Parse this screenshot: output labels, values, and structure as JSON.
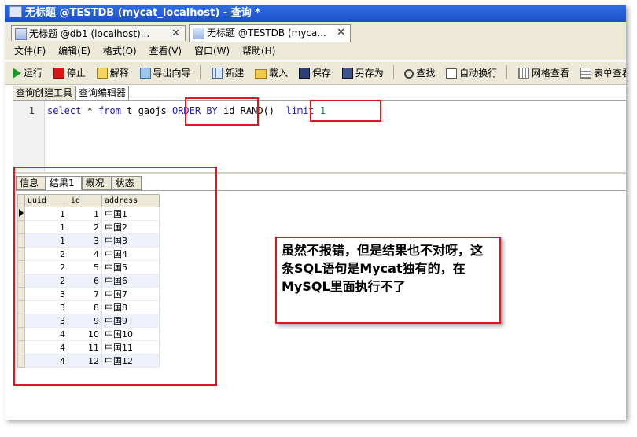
{
  "window": {
    "title": "无标题 @TESTDB (mycat_localhost) - 查询 *"
  },
  "tabs": [
    {
      "label": "无标题 @db1 (localhost)...",
      "close": "✕"
    },
    {
      "label": "无标题 @TESTDB (myca...",
      "close": "✕"
    }
  ],
  "menu": [
    "文件(F)",
    "编辑(E)",
    "格式(O)",
    "查看(V)",
    "窗口(W)",
    "帮助(H)"
  ],
  "toolbar": {
    "run": "运行",
    "stop": "停止",
    "explain": "解释",
    "export": "导出向导",
    "new": "新建",
    "load": "载入",
    "save": "保存",
    "save_as": "另存为",
    "find": "查找",
    "wrap": "自动换行",
    "grid_view": "网格查看",
    "form_view": "表单查看"
  },
  "subtabs": [
    "查询创建工具",
    "查询编辑器"
  ],
  "editor": {
    "line": "1",
    "select": "select",
    "star": " * ",
    "from": "from",
    "table": " t_gaojs ",
    "order_by": "ORDER BY",
    "col": " id RAND()  ",
    "limit": "limit",
    "limit_value": " 1"
  },
  "result_tabs": [
    "信息",
    "结果1",
    "概况",
    "状态"
  ],
  "grid": {
    "columns": [
      "uuid",
      "id",
      "address"
    ],
    "rows": [
      [
        "1",
        "1",
        "中国1"
      ],
      [
        "1",
        "2",
        "中国2"
      ],
      [
        "1",
        "3",
        "中国3"
      ],
      [
        "2",
        "4",
        "中国4"
      ],
      [
        "2",
        "5",
        "中国5"
      ],
      [
        "2",
        "6",
        "中国6"
      ],
      [
        "3",
        "7",
        "中国7"
      ],
      [
        "3",
        "8",
        "中国8"
      ],
      [
        "3",
        "9",
        "中国9"
      ],
      [
        "4",
        "10",
        "中国10"
      ],
      [
        "4",
        "11",
        "中国11"
      ],
      [
        "4",
        "12",
        "中国12"
      ]
    ]
  },
  "annotation": "虽然不报错，但是结果也不对呀，这条SQL语句是Mycat独有的，在MySQL里面执行不了"
}
